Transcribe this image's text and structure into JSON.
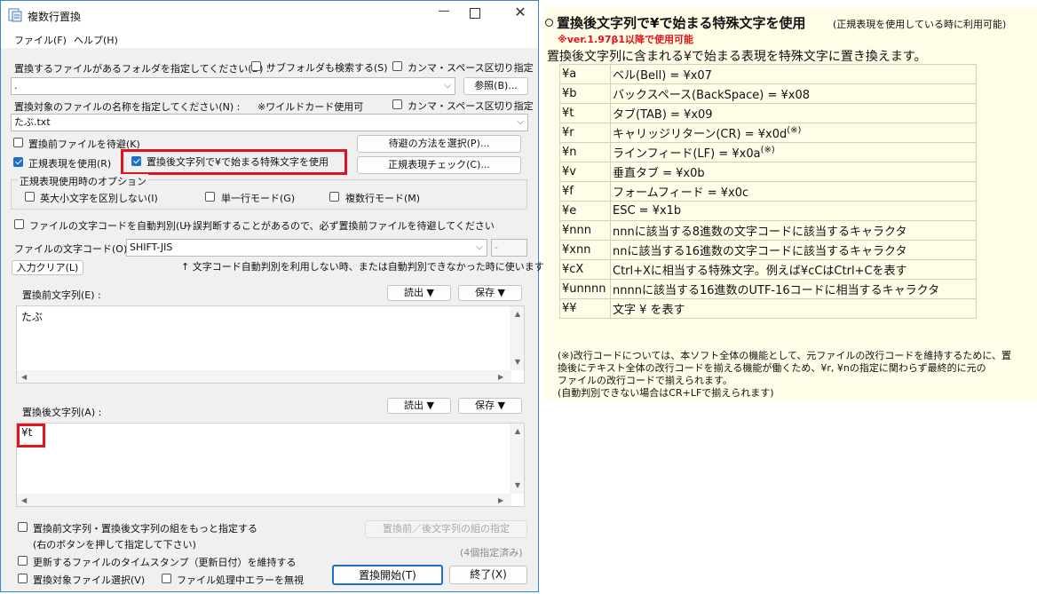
{
  "window": {
    "title": "複数行置換",
    "menu": [
      "ファイル(F)",
      "ヘルプ(H)"
    ]
  },
  "folder": {
    "label": "置換するファイルがあるフォルダを指定してください(D) :",
    "subfolder_label": "サブフォルダも検索する(S)",
    "subfolder_checked": false,
    "comma_label": "カンマ・スペース区切り指定",
    "comma_checked": false,
    "value": ".",
    "browse_button": "参照(B)..."
  },
  "filename": {
    "label": "置換対象のファイルの名称を指定してください(N) :",
    "wildcard_note": "※ワイルドカード使用可",
    "comma_label": "カンマ・スペース区切り指定",
    "comma_checked": false,
    "value": "たぶ.txt"
  },
  "options": {
    "backup_label": "置換前ファイルを待避(K)",
    "backup_checked": false,
    "backup_method_button": "待避の方法を選択(P)...",
    "regex_label": "正規表現を使用(R)",
    "regex_checked": true,
    "escape_label": "置換後文字列で¥で始まる特殊文字を使用",
    "escape_checked": true,
    "regex_check_button": "正規表現チェック(C)..."
  },
  "regex_options": {
    "group_label": "正規表現使用時のオプション",
    "ignore_case_label": "英大小文字を区別しない(I)",
    "ignore_case_checked": false,
    "single_line_label": "単一行モード(G)",
    "single_line_checked": false,
    "multi_line_label": "複数行モード(M)",
    "multi_line_checked": false
  },
  "encoding": {
    "auto_label": "ファイルの文字コードを自動判別(U)",
    "auto_checked": false,
    "auto_warning": "－誤判断することがあるので、必ず置換前ファイルを待避してください",
    "label": "ファイルの文字コード(O) :",
    "value": "SHIFT-JIS",
    "side_value": "-",
    "clear_button": "入力クリア(L)",
    "note": "↑ 文字コード自動判別を利用しない時、または自動判別できなかった時に使います。"
  },
  "before": {
    "label": "置換前文字列(E) :",
    "read_button": "読出 ▼",
    "save_button": "保存 ▼",
    "text": "たぶ"
  },
  "after": {
    "label": "置換後文字列(A) :",
    "read_button": "読出 ▼",
    "save_button": "保存 ▼",
    "text": "¥t"
  },
  "bottom": {
    "multi_pair_label": "置換前文字列・置換後文字列の組をもっと指定する",
    "multi_pair_checked": false,
    "multi_pair_note": "(右のボタンを押して指定して下さい)",
    "pair_button": "置換前／後文字列の組の指定",
    "pair_count": "(4個指定済み)",
    "timestamp_label": "更新するファイルのタイムスタンプ（更新日付）を維持する",
    "timestamp_checked": false,
    "select_label": "置換対象ファイル選択(V)",
    "select_checked": false,
    "ignore_error_label": "ファイル処理中エラーを無視",
    "ignore_error_checked": false,
    "start_button": "置換開始(T)",
    "exit_button": "終了(X)"
  },
  "help": {
    "heading": "置換後文字列で¥で始まる特殊文字を使用",
    "heading_note": "(正規表現を使用している時に利用可能)",
    "version_note": "※ver.1.97β1以降で使用可能",
    "intro": "置換後文字列に含まれる¥で始まる表現を特殊文字に置き換えます。",
    "rows": [
      {
        "key": "¥a",
        "desc": "ベル(Bell) = ¥x07",
        "sup": ""
      },
      {
        "key": "¥b",
        "desc": "バックスペース(BackSpace) = ¥x08",
        "sup": ""
      },
      {
        "key": "¥t",
        "desc": "タブ(TAB) = ¥x09",
        "sup": ""
      },
      {
        "key": "¥r",
        "desc": "キャリッジリターン(CR) = ¥x0d",
        "sup": "(※)"
      },
      {
        "key": "¥n",
        "desc": "ラインフィード(LF) = ¥x0a",
        "sup": "(※)"
      },
      {
        "key": "¥v",
        "desc": "垂直タブ = ¥x0b",
        "sup": ""
      },
      {
        "key": "¥f",
        "desc": "フォームフィード = ¥x0c",
        "sup": ""
      },
      {
        "key": "¥e",
        "desc": "ESC = ¥x1b",
        "sup": ""
      },
      {
        "key": "¥nnn",
        "desc": "nnnに該当する8進数の文字コードに該当するキャラクタ",
        "sup": ""
      },
      {
        "key": "¥xnn",
        "desc": "nnに該当する16進数の文字コードに該当するキャラクタ",
        "sup": ""
      },
      {
        "key": "¥cX",
        "desc": "Ctrl+Xに相当する特殊文字。例えば¥cCはCtrl+Cを表す",
        "sup": ""
      },
      {
        "key": "¥unnnn",
        "desc": "nnnnに該当する16進数のUTF-16コードに相当するキャラクタ",
        "sup": ""
      },
      {
        "key": "¥¥",
        "desc": "文字 ¥ を表す",
        "sup": ""
      }
    ],
    "footnote_1": "(※)改行コードについては、本ソフト全体の機能として、元ファイルの改行コードを維持するために、置",
    "footnote_2": "換後にテキスト全体の改行コードを揃える機能が働くため、¥r, ¥nの指定に関わらず最終的に元の",
    "footnote_3": "ファイルの改行コードで揃えられます。",
    "footnote_4": "(自動判別できない場合はCR+LFで揃えられます)"
  },
  "colors": {
    "highlight": "#e0141a",
    "accent": "#1f6fc5",
    "version_note": "#e0141a",
    "panel_bg": "#fffde8"
  }
}
